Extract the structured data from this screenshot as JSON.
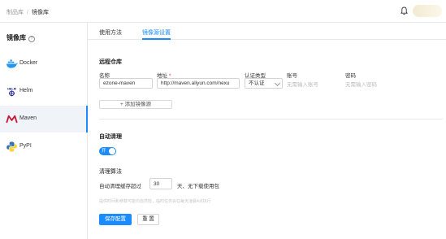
{
  "breadcrumb": {
    "parent": "制品库",
    "separator": "/",
    "current": "镜像库"
  },
  "header": {
    "bell_icon": "bell-icon"
  },
  "sidebar": {
    "title": "镜像库",
    "help_glyph": "?",
    "items": [
      {
        "label": "Docker",
        "icon": "docker-icon",
        "active": false
      },
      {
        "label": "Helm",
        "icon": "helm-icon",
        "active": false
      },
      {
        "label": "Maven",
        "icon": "maven-icon",
        "active": true
      },
      {
        "label": "PyPI",
        "icon": "pypi-icon",
        "active": false
      }
    ]
  },
  "tabs": [
    {
      "label": "使用方法",
      "active": false
    },
    {
      "label": "镜像源设置",
      "active": true
    }
  ],
  "remote": {
    "title": "远程仓库",
    "columns": {
      "name": "名称",
      "url": "地址",
      "required_mark": "*",
      "auth_type": "认证类型",
      "account": "账号",
      "password": "密码"
    },
    "row": {
      "name": "ezone-maven",
      "url": "http://maven.aliyun.com/nexu",
      "auth_type": "不认证",
      "account_placeholder": "无需输入账号",
      "password_placeholder": "无需输入密码"
    },
    "add_button": "+ 添加镜像源"
  },
  "auto_clean": {
    "title": "自动清理",
    "toggle_label": "开",
    "enabled": true,
    "algo_title": "清理算法",
    "rule_prefix": "自动清理缓存超过",
    "days": "30",
    "rule_suffix": "天、无下载使用包",
    "hint": "提供时间和参数可能均自然检，临时任务会在每天凌晨4点执行"
  },
  "actions": {
    "save": "保存配置",
    "reset": "重 置"
  },
  "colors": {
    "primary": "#1a8cff",
    "border": "#e8e8e8",
    "active_bg": "#f0f3f7"
  }
}
